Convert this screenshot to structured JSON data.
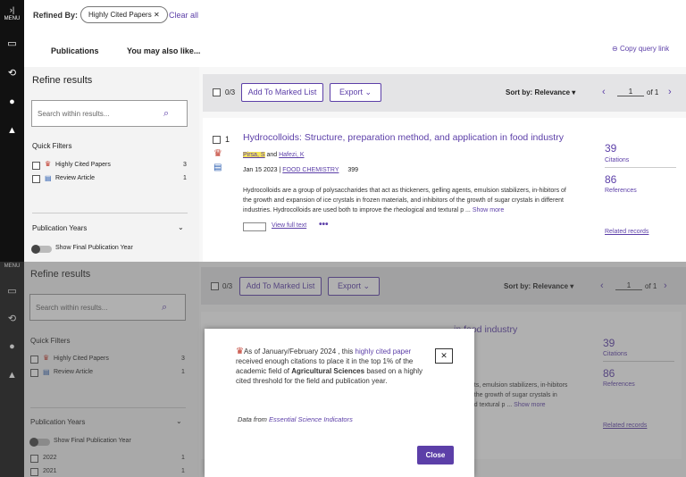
{
  "nav": {
    "expand_label": "MENU",
    "menu_label": "MENU"
  },
  "top": {
    "refined_by": "Refined By:",
    "chip": "Highly Cited Papers",
    "clear_all": "Clear all",
    "tab_publications": "Publications",
    "tab_you_may_like": "You may also like...",
    "copy_query": "Copy query link"
  },
  "refine": {
    "title": "Refine results",
    "search_placeholder": "Search within results...",
    "quick_filters": "Quick Filters",
    "filters": [
      {
        "label": "Highly Cited Papers",
        "count": "3"
      },
      {
        "label": "Review Article",
        "count": "1"
      }
    ],
    "pub_years": "Publication Years",
    "show_final": "Show Final Publication Year",
    "years": [
      {
        "label": "2022",
        "count": "1"
      },
      {
        "label": "2021",
        "count": "1"
      }
    ]
  },
  "toolbar": {
    "count": "0/3",
    "marked_list": "Add To Marked List",
    "export": "Export",
    "sort": "Sort by: Relevance",
    "page": "1",
    "of": "of 1"
  },
  "result": {
    "index": "1",
    "title": "Hydrocolloids: Structure, preparation method, and application in food industry",
    "author1": "Pirsa, S",
    "and": "and",
    "author2": "Hafezi, K",
    "date": "Jan 15 2023 |",
    "journal": "FOOD CHEMISTRY",
    "number": "399",
    "abstract": "Hydrocolloids are a group of polysaccharides that act as thickeners, gelling agents, emulsion stabilizers, in-hibitors of the growth and expansion of ice crystals in frozen materials, and inhibitors of the growth of sugar crystals in different industries. Hydrocolloids are used both to improve the rheological and textural p ...",
    "show_more": "Show more",
    "view_full": "View full text",
    "citations_num": "39",
    "citations": "Citations",
    "refs_num": "86",
    "references": "References",
    "related": "Related records"
  },
  "result2": {
    "title": "Hydrocolloids: Structure, preparation method, and application in food industry",
    "abstract1": "ents, emulsion stabilizers, in-hibitors",
    "abstract2": "of the growth of sugar crystals in",
    "abstract3": "and textural p ...",
    "show_more": "Show more",
    "citations_num": "39",
    "citations": "Citations",
    "refs_num": "86",
    "references": "References",
    "related": "Related records"
  },
  "modal": {
    "text_a": "As of January/February 2024 , this",
    "link1": "highly cited paper",
    "text_b": "received enough citations to place it in the top 1% of the academic field of",
    "field": "Agricultural Sciences",
    "text_c": "based on a highly cited threshold for the field and publication year.",
    "data_from": "Data from",
    "esi": "Essential Science Indicators",
    "close": "Close",
    "close_x": "✕"
  },
  "colors": {
    "accent": "#5c3fa8",
    "trophy": "#c0392b"
  }
}
